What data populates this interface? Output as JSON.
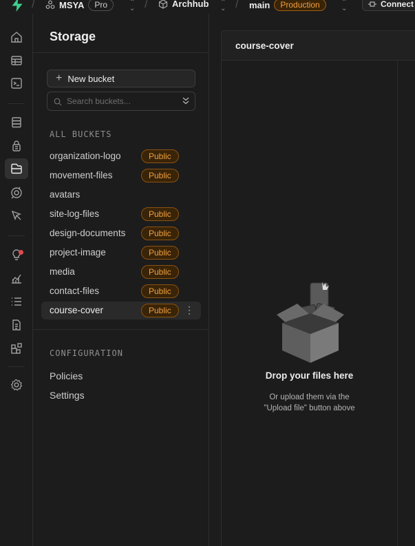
{
  "topbar": {
    "org": "MSYA",
    "plan": "Pro",
    "project": "Archhub",
    "branch": "main",
    "environment": "Production",
    "connect_label": "Connect"
  },
  "rail": {
    "icons": [
      "home-icon",
      "table-editor-icon",
      "sql-editor-icon",
      "database-icon",
      "auth-icon",
      "storage-icon",
      "edge-functions-icon",
      "realtime-icon",
      "advisors-icon",
      "reports-icon",
      "logs-icon",
      "api-docs-icon",
      "integrations-icon",
      "settings-icon"
    ],
    "active": "storage-icon"
  },
  "sidebar": {
    "title": "Storage",
    "new_bucket_label": "New bucket",
    "search_placeholder": "Search buckets...",
    "all_buckets_label": "ALL BUCKETS",
    "buckets": [
      {
        "name": "organization-logo",
        "badge": "Public"
      },
      {
        "name": "movement-files",
        "badge": "Public"
      },
      {
        "name": "avatars",
        "badge": ""
      },
      {
        "name": "site-log-files",
        "badge": "Public"
      },
      {
        "name": "design-documents",
        "badge": "Public"
      },
      {
        "name": "project-image",
        "badge": "Public"
      },
      {
        "name": "media",
        "badge": "Public"
      },
      {
        "name": "contact-files",
        "badge": "Public"
      },
      {
        "name": "course-cover",
        "badge": "Public"
      }
    ],
    "active_bucket": "course-cover",
    "configuration_label": "CONFIGURATION",
    "config_links": [
      "Policies",
      "Settings"
    ]
  },
  "main": {
    "bucket_title": "course-cover",
    "drop_title": "Drop your files here",
    "drop_line1": "Or upload them via the",
    "drop_line2": "\"Upload file\" button above"
  },
  "colors": {
    "accent_green": "#3ecf8e",
    "badge_orange": "#f0a040",
    "background": "#1c1c1c"
  }
}
